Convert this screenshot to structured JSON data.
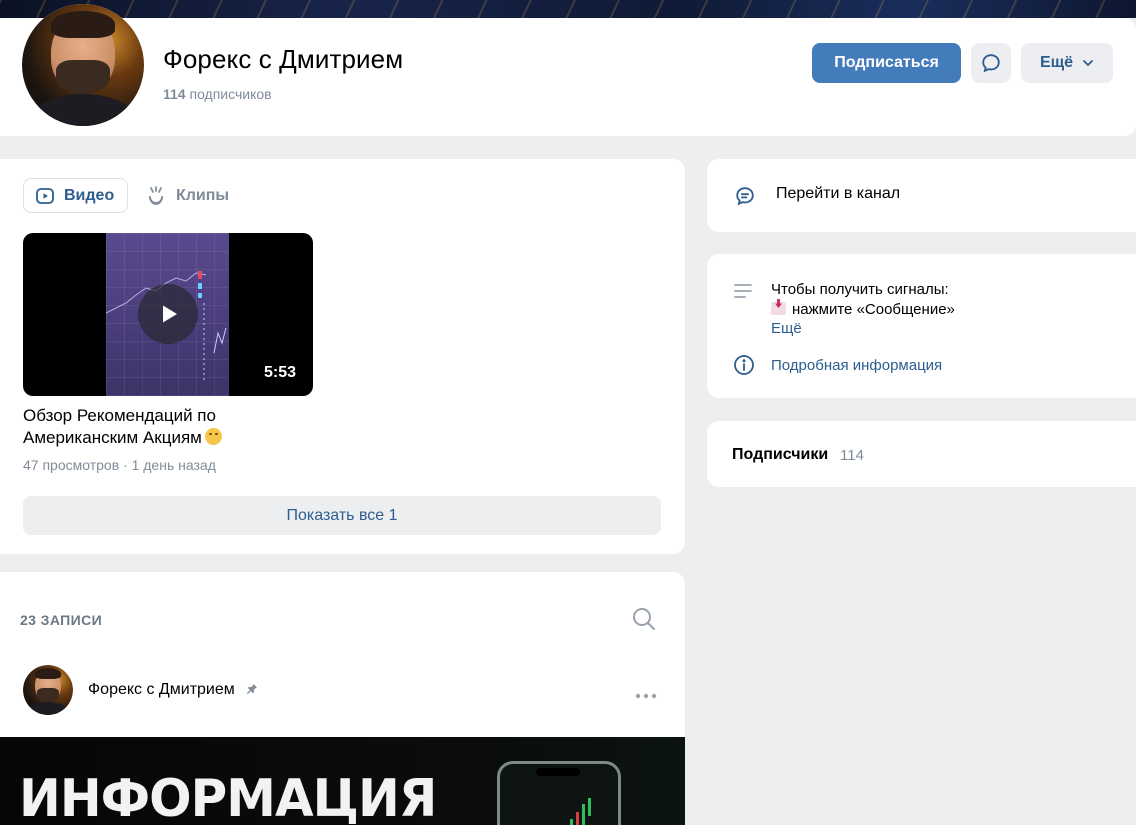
{
  "group": {
    "name": "Форекс с Дмитрием",
    "subscribers_count": "114",
    "subscribers_label": "подписчиков"
  },
  "header_actions": {
    "subscribe_label": "Подписаться",
    "more_label": "Ещё"
  },
  "video_section": {
    "tabs": [
      {
        "label": "Видео",
        "active": true
      },
      {
        "label": "Клипы",
        "active": false
      }
    ],
    "video": {
      "title": "Обзор Рекомендаций по Американским Акциям",
      "duration": "5:53",
      "meta": "47 просмотров · 1 день назад"
    },
    "show_all_label": "Показать все 1"
  },
  "posts": {
    "count_label": "23 ЗАПИСИ",
    "author": "Форекс с Дмитрием",
    "image_headline": "ИНФОРМАЦИЯ"
  },
  "sidebar": {
    "go_channel_label": "Перейти в канал",
    "info_line1": "Чтобы получить сигналы:",
    "info_line2": "нажмите «Сообщение»",
    "info_more": "Ещё",
    "info_detail": "Подробная информация",
    "subscribers_title": "Подписчики",
    "subscribers_count": "114"
  },
  "colors": {
    "accent": "#447bba",
    "link": "#2c5d8f",
    "secondary_text": "#818c99",
    "background": "#edeef0"
  },
  "icons": [
    "play-icon",
    "clips-icon",
    "message-icon",
    "chevron-down-icon",
    "search-icon",
    "pin-icon",
    "more-dots-icon",
    "channel-icon",
    "description-icon",
    "info-icon"
  ]
}
